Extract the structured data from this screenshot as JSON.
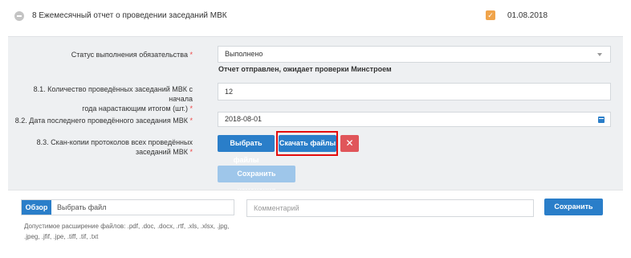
{
  "header": {
    "title": "8 Ежемесячный отчет о проведении заседаний МВК",
    "check_glyph": "✓",
    "date": "01.08.2018"
  },
  "form": {
    "status": {
      "label": "Статус выполнения обязательства",
      "required_mark": "*",
      "value": "Выполнено",
      "note": "Отчет отправлен, ожидает проверки Минстроем"
    },
    "meetings_count": {
      "label_line1": "8.1. Количество проведённых заседаний МВК с начала",
      "label_line2": "года нарастающим итогом (шт.)",
      "required_mark": "*",
      "value": "12"
    },
    "last_meeting_date": {
      "label": "8.2. Дата последнего проведённого заседания МВК",
      "required_mark": "*",
      "value": "2018-08-01"
    },
    "scans": {
      "label_line1": "8.3. Скан-копии протоколов всех проведённых",
      "label_line2": "заседаний МВК",
      "required_mark": "*",
      "choose_button": "Выбрать файлы",
      "download_button": "Скачать файлы",
      "delete_glyph": "✕"
    },
    "save_changes_button": "Сохранить изменения"
  },
  "upload": {
    "browse_button": "Обзор",
    "file_placeholder": "Выбрать файл",
    "comment_placeholder": "Комментарий",
    "save_button": "Сохранить",
    "allowed_ext_line1": "Допустимое расширение файлов: .pdf, .doc, .docx, .rtf, .xls, .xlsx, .jpg,",
    "allowed_ext_line2": ".jpeg, .jfif, .jpe, .tiff, .tif, .txt"
  },
  "colors": {
    "primary": "#2a7ec9",
    "danger": "#e0555a",
    "highlight": "#e30d0d",
    "check": "#f0a44b"
  }
}
